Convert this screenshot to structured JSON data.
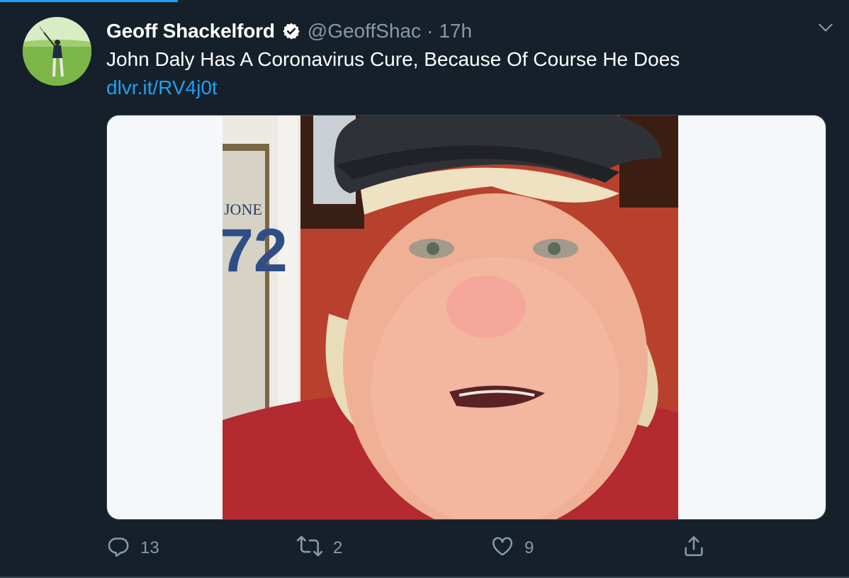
{
  "tweet": {
    "author_name": "Geoff Shackelford",
    "handle": "@GeoffShac",
    "separator": "·",
    "time": "17h",
    "text": "John Daly Has A Coronavirus Cure, Because Of Course He Does",
    "link": "dlvr.it/RV4j0t"
  },
  "media": {
    "jersey_text": "JONE",
    "jersey_number": "72"
  },
  "actions": {
    "replies": "13",
    "retweets": "2",
    "likes": "9",
    "share": ""
  },
  "icons": {
    "verified": "verified-badge-icon",
    "menu": "chevron-down-icon",
    "reply": "reply-icon",
    "retweet": "retweet-icon",
    "like": "heart-icon",
    "share": "share-icon"
  },
  "colors": {
    "background": "#15202b",
    "accent": "#1da1f2",
    "muted": "#8899a6"
  }
}
